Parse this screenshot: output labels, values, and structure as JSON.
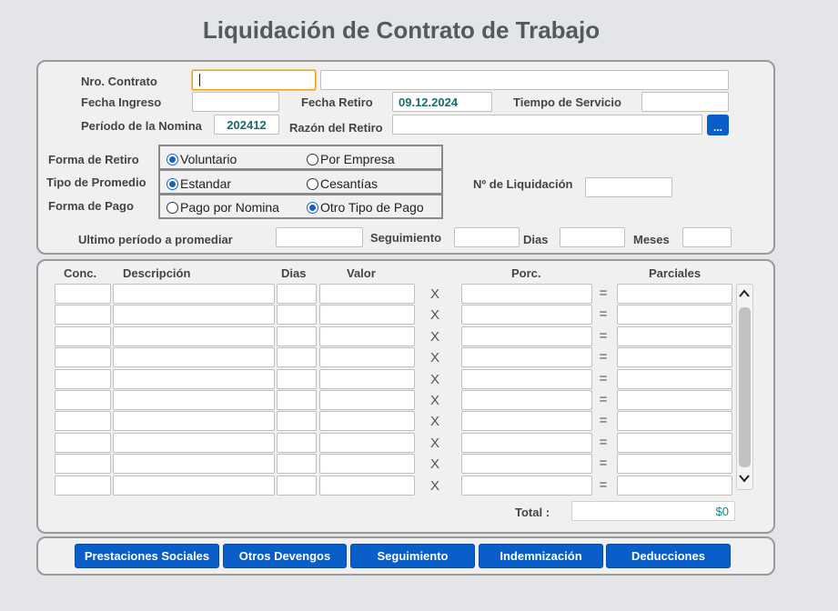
{
  "title": "Liquidación de Contrato de Trabajo",
  "header": {
    "nro_contrato_label": "Nro. Contrato",
    "nro_contrato_value": "",
    "nro_contrato_desc": "",
    "fecha_ingreso_label": "Fecha Ingreso",
    "fecha_ingreso_value": "",
    "fecha_retiro_label": "Fecha  Retiro",
    "fecha_retiro_value": "09.12.2024",
    "tiempo_servicio_label": "Tiempo de Servicio",
    "tiempo_servicio_value": "",
    "periodo_nomina_label": "Período de la Nomina",
    "periodo_nomina_value": "202412",
    "razon_retiro_label": "Razón del Retiro",
    "razon_retiro_value": "",
    "lookup_button_label": "...",
    "forma_retiro_label": "Forma de Retiro",
    "forma_retiro_options": [
      "Voluntario",
      "Por Empresa"
    ],
    "forma_retiro_selected": "Voluntario",
    "tipo_promedio_label": "Tipo de Promedio",
    "tipo_promedio_options": [
      "Estandar",
      "Cesantías"
    ],
    "tipo_promedio_selected": "Estandar",
    "forma_pago_label": "Forma de Pago",
    "forma_pago_options": [
      "Pago por Nomina",
      "Otro Tipo de Pago"
    ],
    "forma_pago_selected": "Otro Tipo de Pago",
    "no_liquidacion_label": "Nº de Liquidación",
    "no_liquidacion_value": "",
    "ultimo_periodo_label": "Ultimo período a promediar",
    "ultimo_periodo_value": "",
    "seguimiento_label": "Seguimiento",
    "seguimiento_value": "",
    "dias_label": "Dias",
    "dias_value": "",
    "meses_label": "Meses",
    "meses_value": ""
  },
  "grid": {
    "columns": [
      "Conc.",
      "Descripción",
      "Dias",
      "Valor",
      "Porc.",
      "Parciales"
    ],
    "multiply_symbol": "X",
    "equals_symbol": "=",
    "row_count": 10,
    "total_label": "Total :",
    "total_value": "$0"
  },
  "buttons": {
    "prestaciones": "Prestaciones Sociales",
    "otros_devengos": "Otros Devengos",
    "seguimiento": "Seguimiento",
    "indemnizacion": "Indemnización",
    "deducciones": "Deducciones"
  },
  "colors": {
    "accent": "#0a5ec8",
    "value_text": "#1b6b6b",
    "background": "#e3e5e8"
  }
}
